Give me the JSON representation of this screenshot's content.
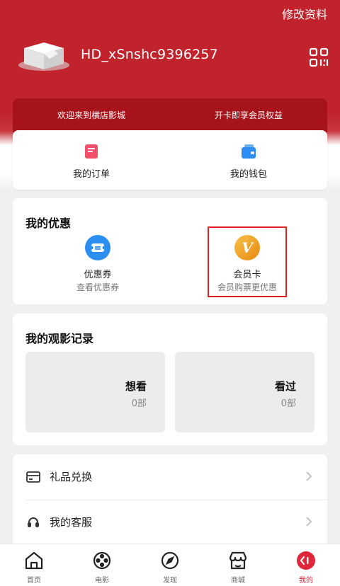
{
  "header": {
    "edit_label": "修改资料",
    "username": "HD_xSnshc9396257"
  },
  "banner": {
    "left": "欢迎来到横店影城",
    "right": "开卡即享会员权益"
  },
  "quick": [
    {
      "label": "我的订单",
      "icon": "order-icon"
    },
    {
      "label": "我的钱包",
      "icon": "wallet-icon"
    }
  ],
  "promo": {
    "title": "我的优惠",
    "coupon": {
      "name": "优惠券",
      "sub": "查看优惠券",
      "icon": "ticket-icon"
    },
    "member": {
      "name": "会员卡",
      "sub": "会员购票更优惠",
      "icon": "vip-v-icon",
      "badge": "V"
    }
  },
  "history": {
    "title": "我的观影记录",
    "want": {
      "label": "想看",
      "count": "0部"
    },
    "seen": {
      "label": "看过",
      "count": "0部"
    }
  },
  "menu": [
    {
      "label": "礼品兑换",
      "icon": "gift-card-icon"
    },
    {
      "label": "我的客服",
      "icon": "headset-icon"
    }
  ],
  "tabs": [
    {
      "label": "首页",
      "icon": "home-icon"
    },
    {
      "label": "电影",
      "icon": "film-reel-icon"
    },
    {
      "label": "发现",
      "icon": "compass-icon"
    },
    {
      "label": "商城",
      "icon": "store-icon"
    },
    {
      "label": "我的",
      "icon": "profile-icon",
      "active": true
    }
  ],
  "colors": {
    "brand_red": "#c0232b",
    "banner_red": "#a6131b",
    "active_tab": "#e0263a",
    "coupon_blue": "#2b8ef0",
    "member_gold": "#f0a21b",
    "highlight": "#e02020"
  }
}
